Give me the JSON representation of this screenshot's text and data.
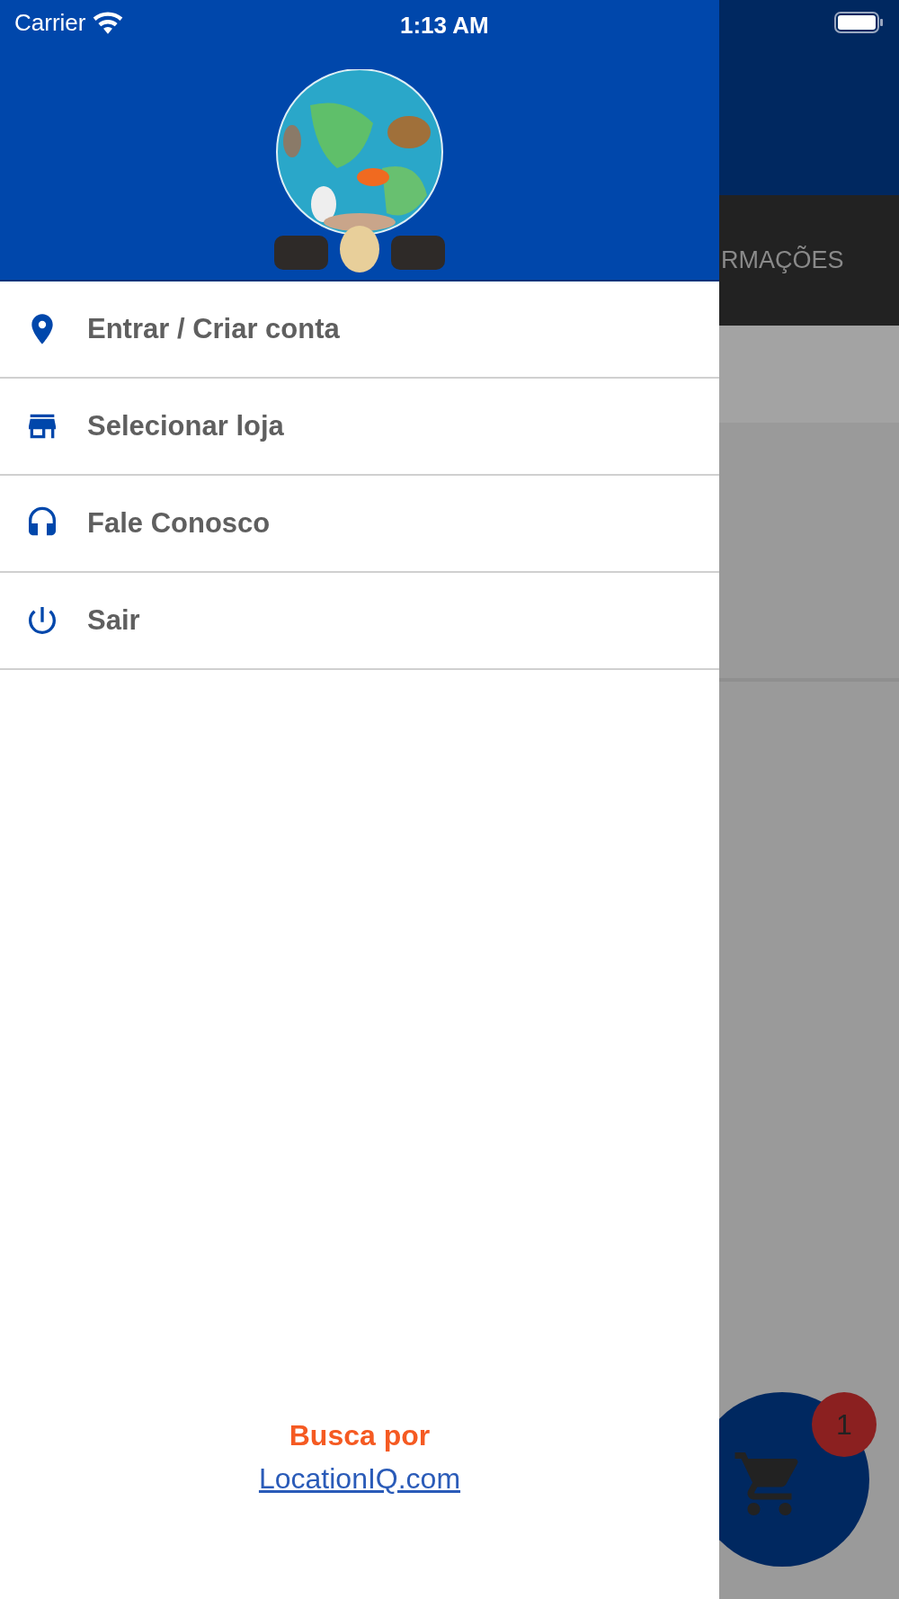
{
  "status_bar": {
    "carrier": "Carrier",
    "time": "1:13 AM"
  },
  "drawer": {
    "menu": [
      {
        "label": "Entrar / Criar conta",
        "kind": "account"
      },
      {
        "label": "Selecionar loja",
        "kind": "store"
      },
      {
        "label": "Fale Conosco",
        "kind": "contact"
      },
      {
        "label": "Sair",
        "kind": "logout"
      }
    ],
    "footer": {
      "label": "Busca por",
      "link": "LocationIQ.com"
    }
  },
  "background": {
    "tab_label": "RMAÇÕES",
    "cart": {
      "badge": "1"
    }
  }
}
